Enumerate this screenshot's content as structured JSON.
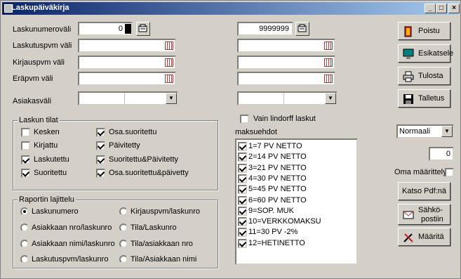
{
  "window": {
    "title": "Laskupäiväkirja",
    "min": "_",
    "max": "□",
    "close": "×"
  },
  "labels": {
    "invoice_range": "Laskunumeroväli",
    "invoice_date": "Laskutuspvm väli",
    "booking_date": "Kirjauspvm väli",
    "due_date": "Eräpvm väli",
    "customer_range": "Asiakasväli"
  },
  "invoice_from": "0",
  "invoice_to": "9999999",
  "only_lindorff": {
    "label": "Vain lindorff laskut",
    "checked": false
  },
  "status_group": {
    "title": "Laskun tilat",
    "items": [
      {
        "label": "Kesken",
        "checked": false
      },
      {
        "label": "Kirjattu",
        "checked": false
      },
      {
        "label": "Laskutettu",
        "checked": true
      },
      {
        "label": "Suoritettu",
        "checked": true
      },
      {
        "label": "Osa.suoritettu",
        "checked": true
      },
      {
        "label": "Päivitetty",
        "checked": true
      },
      {
        "label": "Suoritettu&Päivitetty",
        "checked": true
      },
      {
        "label": "Osa.suoritettu&päivetty",
        "checked": true
      }
    ]
  },
  "sort_group": {
    "title": "Raportin lajittelu",
    "items": [
      {
        "label": "Laskunumero",
        "selected": true
      },
      {
        "label": "Asiakkaan nro/laskunro",
        "selected": false
      },
      {
        "label": "Asiakkaan nimi/laskunro",
        "selected": false
      },
      {
        "label": "Laskutuspvm/laskunro",
        "selected": false
      },
      {
        "label": "Kirjauspvm/laskunro",
        "selected": false
      },
      {
        "label": "Tila/Laskunro",
        "selected": false
      },
      {
        "label": "Tila/asiakkaan nro",
        "selected": false
      },
      {
        "label": "Tila/Asiakkaan nimi",
        "selected": false
      }
    ]
  },
  "payment_terms": {
    "title": "maksuehdot",
    "items": [
      {
        "label": "1=7 PV NETTO",
        "checked": true
      },
      {
        "label": "2=14 PV NETTO",
        "checked": true
      },
      {
        "label": "3=21 PV NETTO",
        "checked": true
      },
      {
        "label": "4=30 PV NETTO",
        "checked": true
      },
      {
        "label": "5=45 PV NETTO",
        "checked": true
      },
      {
        "label": "6=60 PV NETTO",
        "checked": true
      },
      {
        "label": "9=SOP. MUK",
        "checked": true
      },
      {
        "label": "10=VERKKOMAKSU",
        "checked": true
      },
      {
        "label": "11=30 PV -2%",
        "checked": true
      },
      {
        "label": "12=HETINETTO",
        "checked": true
      }
    ]
  },
  "buttons": {
    "exit": "Poistu",
    "preview": "Esikatsele",
    "print": "Tulosta",
    "save": "Talletus",
    "view_pdf": "Katso Pdf:nä",
    "email_line1": "Sähkö-",
    "email_line2": "postiin",
    "define": "Määritä"
  },
  "print_mode": "Normaali",
  "copies": "0",
  "own_definition": {
    "label": "Oma määrittely",
    "checked": false
  },
  "colors": {
    "title_start": "#0a246a",
    "title_end": "#a6caf0",
    "face": "#d4d0c8"
  },
  "icons": {
    "exit": "exit-door-icon",
    "preview": "monitor-icon",
    "print": "printer-icon",
    "save": "floppy-disk-icon",
    "email": "envelope-icon",
    "define": "tools-icon",
    "calendar": "calendar-icon",
    "search": "search-icon"
  }
}
